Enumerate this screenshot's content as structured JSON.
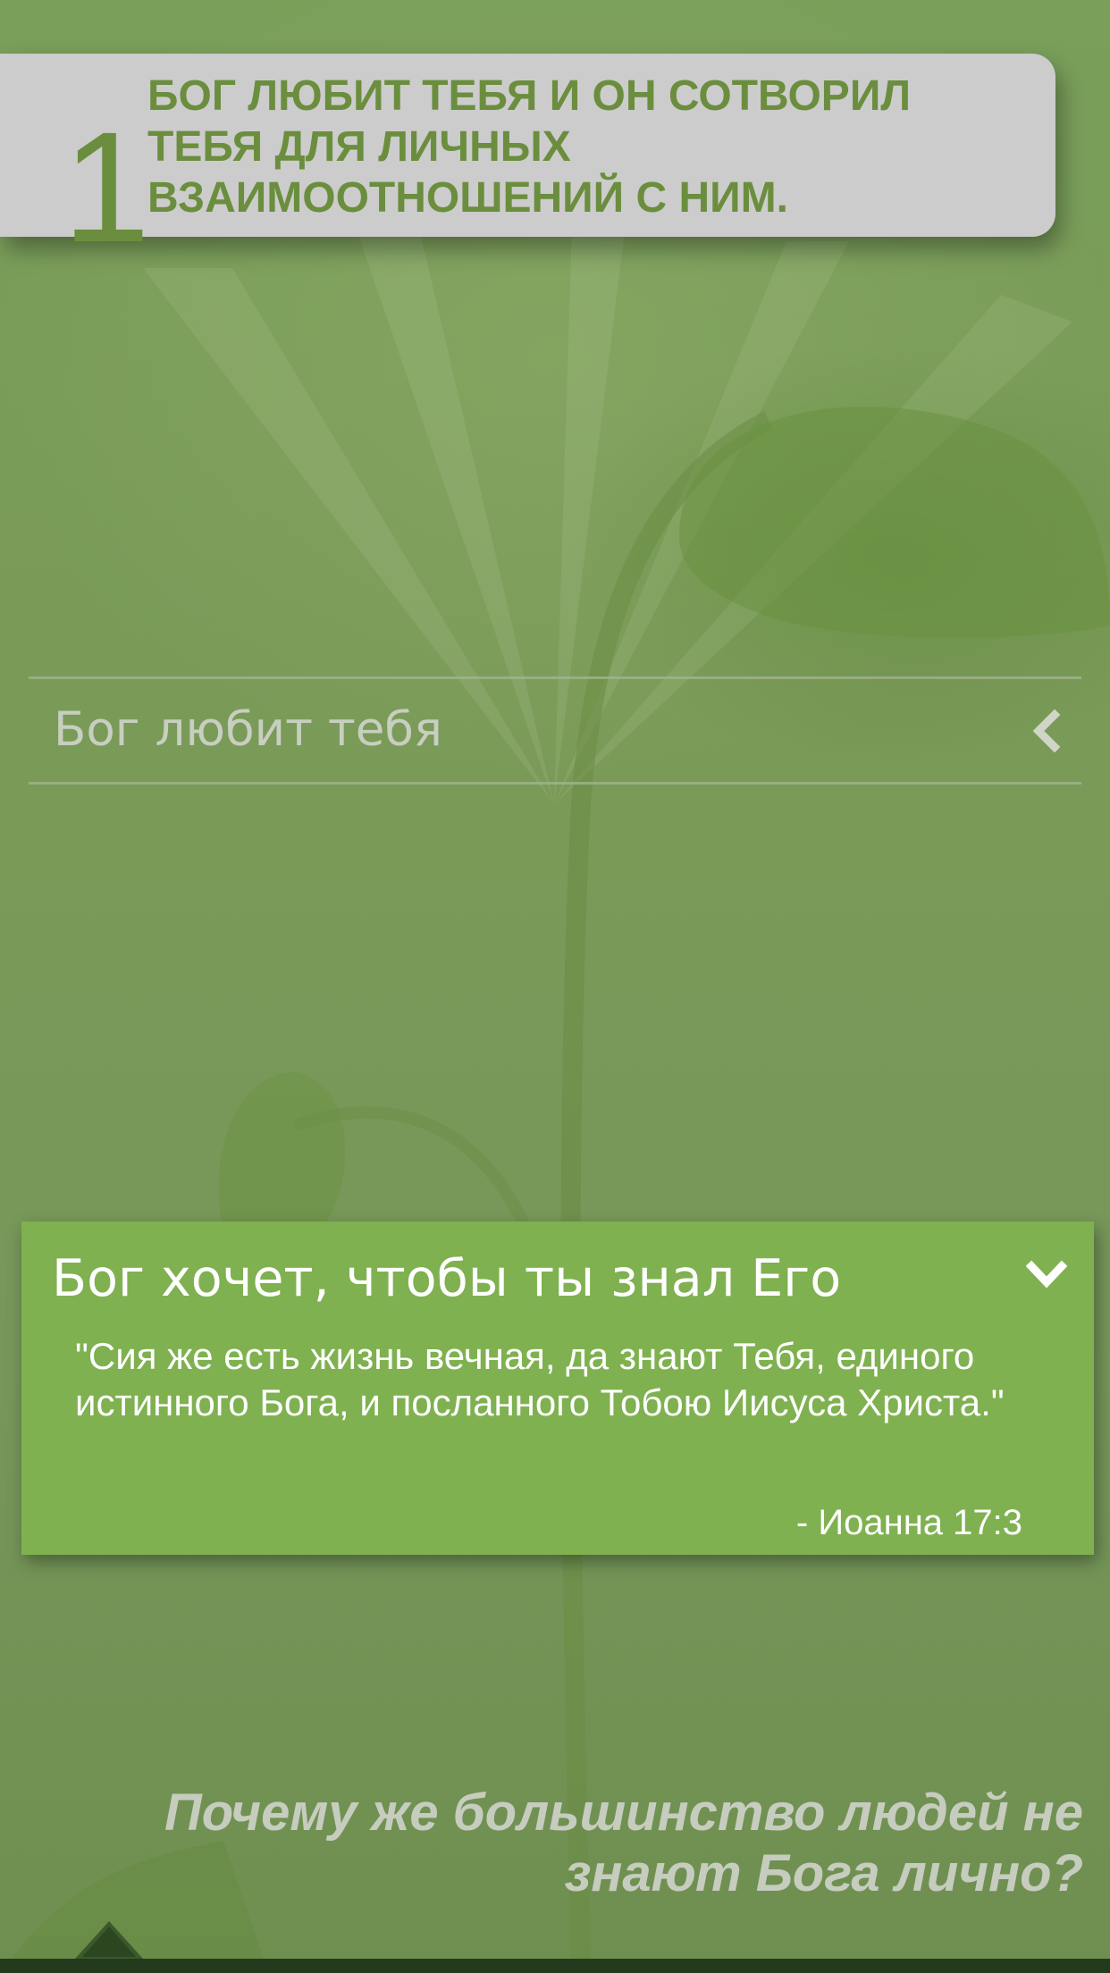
{
  "header": {
    "number": "1",
    "text": "БОГ ЛЮБИТ ТЕБЯ И ОН СОТВОРИЛ ТЕБЯ ДЛЯ ЛИЧНЫХ ВЗАИМООТНОШЕНИЙ С НИМ."
  },
  "sections": {
    "collapsed_title": "Бог любит тебя",
    "collapsed_icon": "chevron-left-icon",
    "open_title": "Бог хочет, чтобы ты знал Его",
    "open_icon": "chevron-down-icon",
    "verse": "\"Сия же есть жизнь вечная, да знают Тебя, единого истинного Бога, и посланного Тобою Иисуса Христа.\"",
    "reference": "- Иоанна 17:3"
  },
  "footer": {
    "question": "Почему же большинство людей не знают Бога лично?",
    "nav_icon": "up-arrow-icon"
  },
  "colors": {
    "background": "#7a9a58",
    "header_card": "#cccccc",
    "header_text": "#6b8e3e",
    "open_panel": "#7fb150",
    "muted_text": "#c7cfc0"
  }
}
